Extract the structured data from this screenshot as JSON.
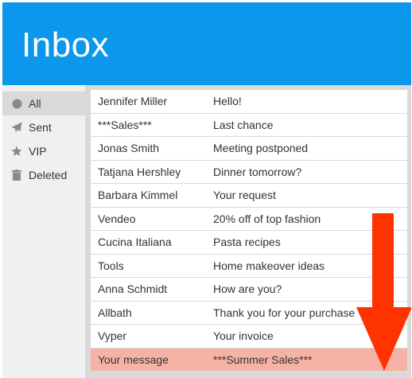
{
  "header": {
    "title": "Inbox"
  },
  "sidebar": {
    "items": [
      {
        "label": "All",
        "icon": "circle-icon",
        "active": true
      },
      {
        "label": "Sent",
        "icon": "paper-plane-icon",
        "active": false
      },
      {
        "label": "VIP",
        "icon": "star-icon",
        "active": false
      },
      {
        "label": "Deleted",
        "icon": "trash-icon",
        "active": false
      }
    ]
  },
  "messages": [
    {
      "sender": "Jennifer Miller",
      "subject": "Hello!"
    },
    {
      "sender": "***Sales***",
      "subject": "Last chance"
    },
    {
      "sender": "Jonas Smith",
      "subject": "Meeting postponed"
    },
    {
      "sender": "Tatjana Hershley",
      "subject": "Dinner tomorrow?"
    },
    {
      "sender": "Barbara Kimmel",
      "subject": "Your request"
    },
    {
      "sender": "Vendeo",
      "subject": "20% off of top fashion"
    },
    {
      "sender": "Cucina Italiana",
      "subject": "Pasta recipes"
    },
    {
      "sender": "Tools",
      "subject": "Home makeover ideas"
    },
    {
      "sender": "Anna Schmidt",
      "subject": "How are you?"
    },
    {
      "sender": "Allbath",
      "subject": "Thank you for your purchase"
    },
    {
      "sender": "Vyper",
      "subject": "Your invoice"
    },
    {
      "sender": "Your message",
      "subject": "***Summer Sales***",
      "highlighted": true
    }
  ],
  "colors": {
    "header_bg": "#0a97ec",
    "highlight_row": "#f6b3a5",
    "arrow": "#ff3300"
  },
  "annotation": {
    "icon": "down-arrow-icon"
  }
}
